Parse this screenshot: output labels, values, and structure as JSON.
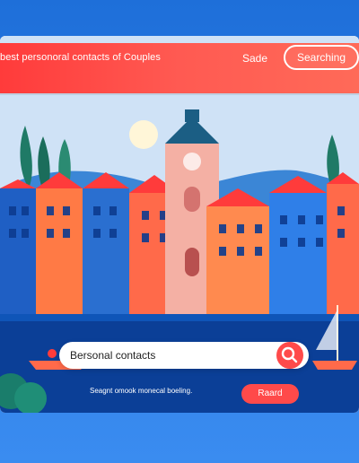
{
  "header": {
    "title": "best personoral contacts of Couples",
    "nav_link": "Sade",
    "search_button": "Searching"
  },
  "search": {
    "value": "Bersonal contacts"
  },
  "footer": {
    "subtext": "Seagnt omook monecal boeling.",
    "read_button": "Raard"
  },
  "icons": {
    "search": "search-icon"
  },
  "colors": {
    "accent": "#ff4a4a",
    "background_blue": "#2f7fe8",
    "header_red": "#ff3b3b"
  }
}
